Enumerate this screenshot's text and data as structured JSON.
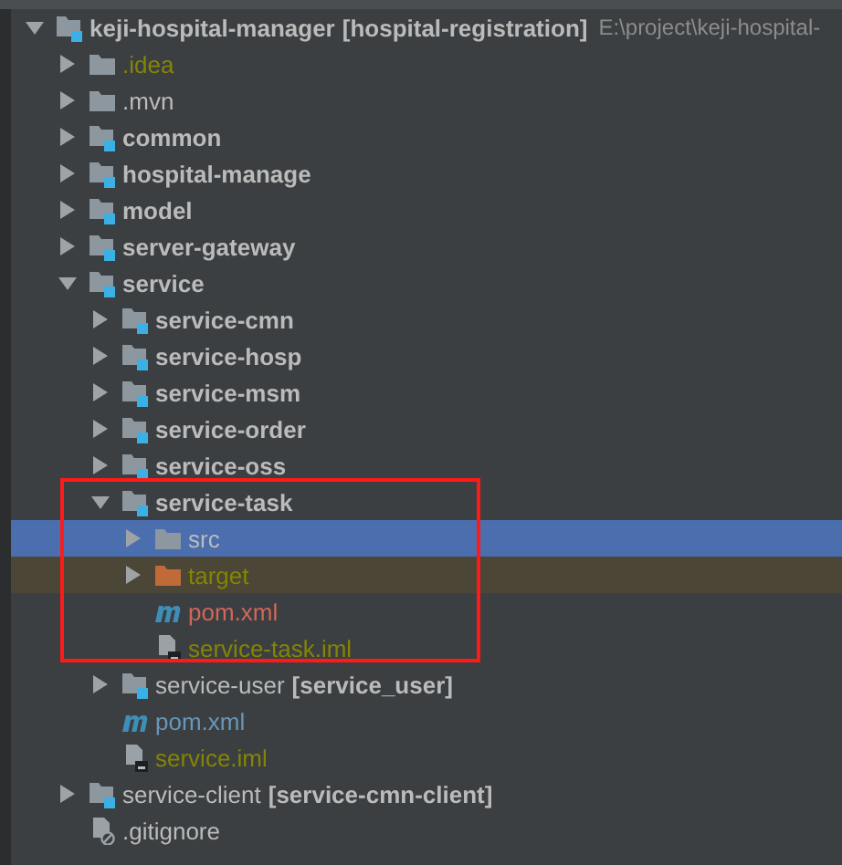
{
  "project_tree": [
    {
      "label": "keji-hospital-manager",
      "suffix": "[hospital-registration]",
      "path": "E:\\project\\keji-hospital-",
      "kind": "module",
      "expanded": true,
      "selected": false,
      "children": [
        {
          "label": ".idea",
          "kind": "folder",
          "color": "#848504",
          "expanded": false,
          "selected": false
        },
        {
          "label": ".mvn",
          "kind": "folder",
          "expanded": false,
          "selected": false
        },
        {
          "label": "common",
          "kind": "module",
          "expanded": false,
          "selected": false
        },
        {
          "label": "hospital-manage",
          "kind": "module",
          "expanded": false,
          "selected": false
        },
        {
          "label": "model",
          "kind": "module",
          "expanded": false,
          "selected": false
        },
        {
          "label": "server-gateway",
          "kind": "module",
          "expanded": false,
          "selected": false
        },
        {
          "label": "service",
          "kind": "module",
          "expanded": true,
          "selected": false,
          "children": [
            {
              "label": "service-cmn",
              "kind": "module",
              "expanded": false,
              "selected": false
            },
            {
              "label": "service-hosp",
              "kind": "module",
              "expanded": false,
              "selected": false
            },
            {
              "label": "service-msm",
              "kind": "module",
              "expanded": false,
              "selected": false
            },
            {
              "label": "service-order",
              "kind": "module",
              "expanded": false,
              "selected": false
            },
            {
              "label": "service-oss",
              "kind": "module",
              "expanded": false,
              "selected": false
            },
            {
              "label": "service-task",
              "kind": "module",
              "expanded": true,
              "selected": false,
              "highlighted": true,
              "children": [
                {
                  "label": "src",
                  "kind": "folder",
                  "expanded": false,
                  "selected": true
                },
                {
                  "label": "target",
                  "kind": "excluded-folder",
                  "color": "#848504",
                  "expanded": false,
                  "selected": false
                },
                {
                  "label": "pom.xml",
                  "kind": "maven",
                  "color": "#d1675a",
                  "selected": false
                },
                {
                  "label": "service-task.iml",
                  "kind": "iml",
                  "color": "#848504",
                  "selected": false
                }
              ]
            },
            {
              "label": "service-user",
              "suffix": "[service_user]",
              "kind": "module-plain",
              "expanded": false,
              "selected": false
            },
            {
              "label": "pom.xml",
              "kind": "maven",
              "color": "#6897bb",
              "selected": false
            },
            {
              "label": "service.iml",
              "kind": "iml",
              "color": "#848504",
              "selected": false
            }
          ]
        },
        {
          "label": "service-client",
          "suffix": "[service-cmn-client]",
          "kind": "module-plain",
          "expanded": false,
          "selected": false
        },
        {
          "label": ".gitignore",
          "kind": "gitignore",
          "selected": false
        }
      ]
    }
  ]
}
